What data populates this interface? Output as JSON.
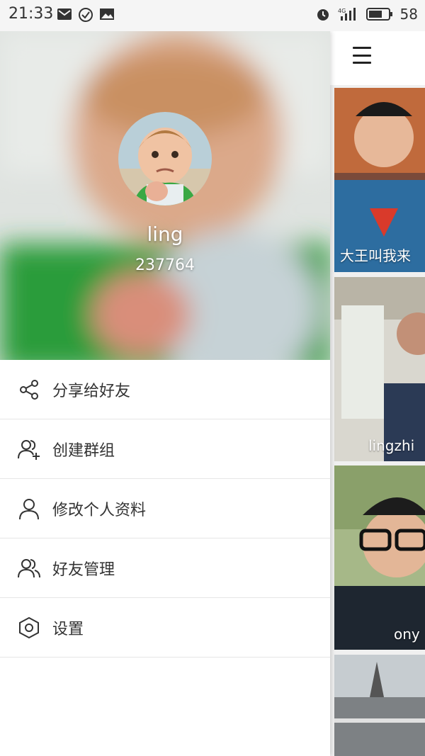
{
  "status_bar": {
    "time": "21:33",
    "network": "4G",
    "battery": "58"
  },
  "profile": {
    "name": "ling",
    "id": "237764"
  },
  "menu": [
    {
      "label": "分享给好友",
      "icon": "share-icon"
    },
    {
      "label": "创建群组",
      "icon": "create-group-icon"
    },
    {
      "label": "修改个人资料",
      "icon": "edit-profile-icon"
    },
    {
      "label": "好友管理",
      "icon": "friends-icon"
    },
    {
      "label": "设置",
      "icon": "settings-icon"
    }
  ],
  "feed": [
    {
      "caption": "大王叫我来"
    },
    {
      "caption": "lingzhi"
    },
    {
      "caption": "ony"
    },
    {
      "caption": ""
    }
  ],
  "colors": {
    "header_green": "#2e9a3a",
    "drawer_bg": "#ffffff",
    "text": "#333333"
  }
}
